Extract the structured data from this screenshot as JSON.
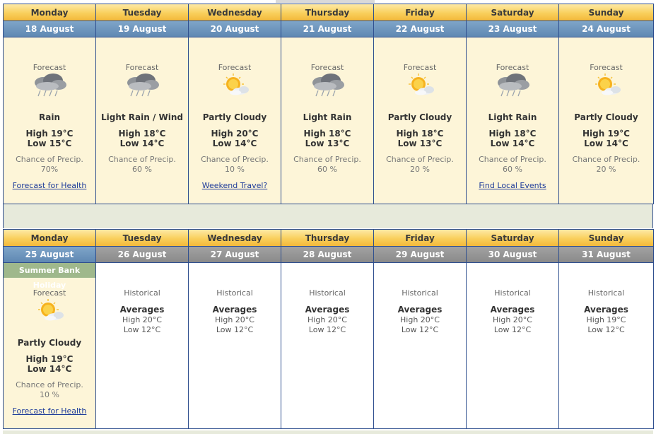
{
  "week1": {
    "days": [
      {
        "name": "Monday",
        "date": "18 August",
        "label": "Forecast",
        "icon": "rain-cloud-icon",
        "condition": "Rain",
        "high": "High 19°C",
        "low": "Low 15°C",
        "chance": "Chance of Precip.",
        "pct": "70%",
        "link": "Forecast for Health"
      },
      {
        "name": "Tuesday",
        "date": "19 August",
        "label": "Forecast",
        "icon": "rain-cloud-icon",
        "condition": "Light Rain / Wind",
        "high": "High 18°C",
        "low": "Low 14°C",
        "chance": "Chance of Precip.",
        "pct": "60 %",
        "link": ""
      },
      {
        "name": "Wednesday",
        "date": "20 August",
        "label": "Forecast",
        "icon": "partly-cloudy-sun-icon",
        "condition": "Partly Cloudy",
        "high": "High 20°C",
        "low": "Low 14°C",
        "chance": "Chance of Precip.",
        "pct": "10 %",
        "link": "Weekend Travel?"
      },
      {
        "name": "Thursday",
        "date": "21 August",
        "label": "Forecast",
        "icon": "rain-cloud-icon",
        "condition": "Light Rain",
        "high": "High 18°C",
        "low": "Low 13°C",
        "chance": "Chance of Precip.",
        "pct": "60 %",
        "link": ""
      },
      {
        "name": "Friday",
        "date": "22 August",
        "label": "Forecast",
        "icon": "partly-cloudy-sun-icon",
        "condition": "Partly Cloudy",
        "high": "High 18°C",
        "low": "Low 13°C",
        "chance": "Chance of Precip.",
        "pct": "20 %",
        "link": ""
      },
      {
        "name": "Saturday",
        "date": "23 August",
        "label": "Forecast",
        "icon": "rain-cloud-icon",
        "condition": "Light Rain",
        "high": "High 18°C",
        "low": "Low 14°C",
        "chance": "Chance of Precip.",
        "pct": "60 %",
        "link": "Find Local Events"
      },
      {
        "name": "Sunday",
        "date": "24 August",
        "label": "Forecast",
        "icon": "partly-cloudy-sun-icon",
        "condition": "Partly Cloudy",
        "high": "High 19°C",
        "low": "Low 14°C",
        "chance": "Chance of Precip.",
        "pct": "20 %",
        "link": ""
      }
    ]
  },
  "week2": {
    "holiday": "Summer Bank Holiday",
    "first": {
      "name": "Monday",
      "date": "25 August",
      "label": "Forecast",
      "icon": "partly-cloudy-sun-icon",
      "condition": "Partly Cloudy",
      "high": "High 19°C",
      "low": "Low 14°C",
      "chance": "Chance of Precip.",
      "pct": "10 %",
      "link": "Forecast for Health"
    },
    "days": [
      {
        "name": "Tuesday",
        "date": "26 August",
        "label": "Historical",
        "avg": "Averages",
        "high": "High 20°C",
        "low": "Low 12°C"
      },
      {
        "name": "Wednesday",
        "date": "27 August",
        "label": "Historical",
        "avg": "Averages",
        "high": "High 20°C",
        "low": "Low 12°C"
      },
      {
        "name": "Thursday",
        "date": "28 August",
        "label": "Historical",
        "avg": "Averages",
        "high": "High 20°C",
        "low": "Low 12°C"
      },
      {
        "name": "Friday",
        "date": "29 August",
        "label": "Historical",
        "avg": "Averages",
        "high": "High 20°C",
        "low": "Low 12°C"
      },
      {
        "name": "Saturday",
        "date": "30 August",
        "label": "Historical",
        "avg": "Averages",
        "high": "High 20°C",
        "low": "Low 12°C"
      },
      {
        "name": "Sunday",
        "date": "31 August",
        "label": "Historical",
        "avg": "Averages",
        "high": "High 19°C",
        "low": "Low 12°C"
      }
    ]
  },
  "colors": {
    "accent": "#f9cf5c",
    "date_blue": "#5f88b3",
    "date_gray": "#8a8a8a",
    "link": "#1f3c9a",
    "panel": "#fdf5d8",
    "holiday": "#9fb88c"
  }
}
